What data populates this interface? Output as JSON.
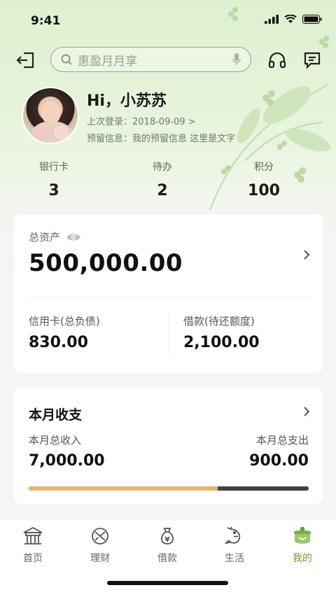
{
  "status_bar": {
    "time": "9:41"
  },
  "search": {
    "placeholder": "惠盈月月享"
  },
  "profile": {
    "greeting": "Hi，小苏苏",
    "last_login": "上次登录：2018-09-09 >",
    "reserved_info": "预留信息：我的预留信息 这里是文字"
  },
  "stats": [
    {
      "label": "银行卡",
      "value": "3"
    },
    {
      "label": "待办",
      "value": "2"
    },
    {
      "label": "积分",
      "value": "100"
    }
  ],
  "assets_card": {
    "label": "总资产",
    "value": "500,000.00",
    "credit_label": "信用卡(总负债)",
    "credit_value": "830.00",
    "loan_label": "借款(待还额度)",
    "loan_value": "2,100.00"
  },
  "monthly_card": {
    "title": "本月收支",
    "income_label": "本月总收入",
    "income_value": "7,000.00",
    "expense_label": "本月总支出",
    "expense_value": "900.00",
    "income_share": 0.675
  },
  "tabs": [
    {
      "label": "首页",
      "icon": "pavilion-icon"
    },
    {
      "label": "理财",
      "icon": "wealth-icon"
    },
    {
      "label": "借款",
      "icon": "money-bag-icon"
    },
    {
      "label": "生活",
      "icon": "fish-icon"
    },
    {
      "label": "我的",
      "icon": "profile-pot-icon",
      "active": true
    }
  ],
  "colors": {
    "accent_green": "#6a9a3d",
    "income_bar": "#e8b270",
    "expense_bar": "#3e4047"
  }
}
